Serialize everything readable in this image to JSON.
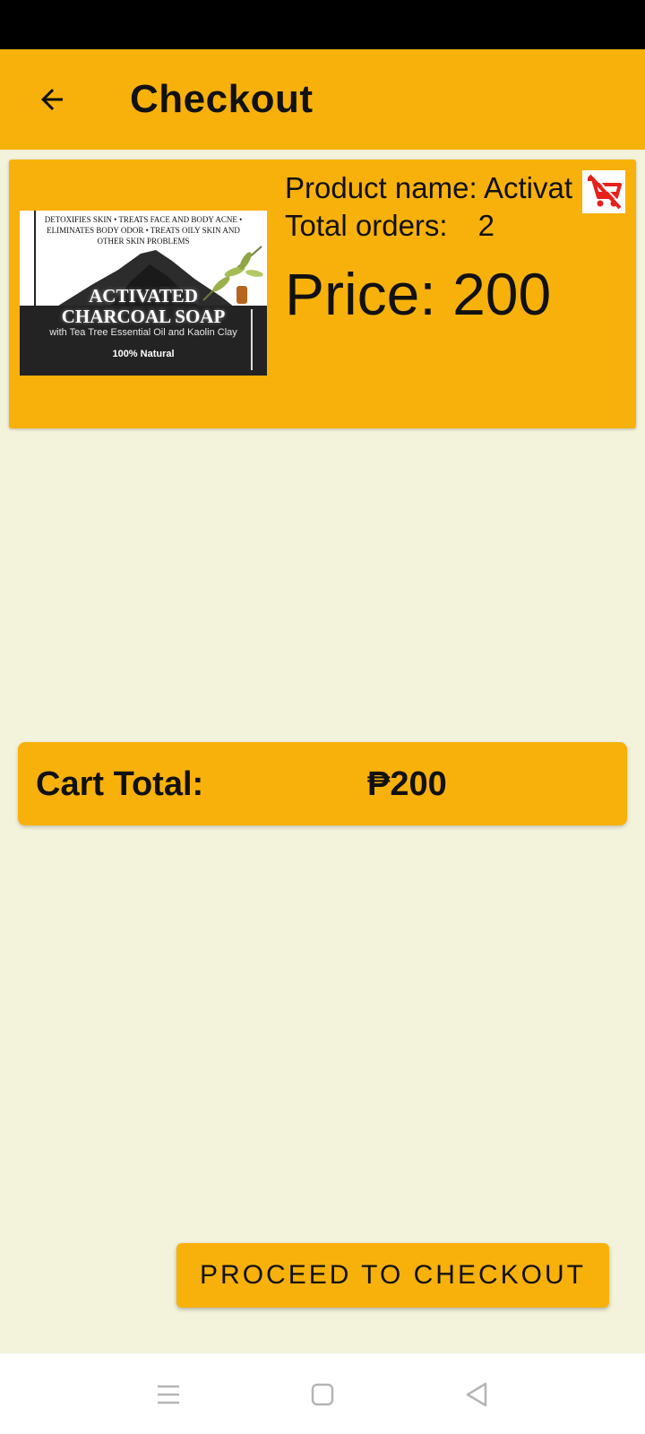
{
  "app_bar": {
    "title": "Checkout",
    "back_icon": "arrow-left-icon",
    "background_color": "#f8b10b"
  },
  "cart_item": {
    "product_name_label": "Product name:",
    "product_name": "Activated Charcoal Soap",
    "total_orders_label": "Total orders:",
    "total_orders": "2",
    "price_label": "Price:",
    "price": "200",
    "remove_icon": "remove-from-cart-icon",
    "image": {
      "header_text": "Detoxifies Skin • Treats Face and Body Acne • Eliminates Body Odor • Treats Oily Skin and Other Skin Problems",
      "title_line1": "ACTIVATED",
      "title_line2": "CHARCOAL SOAP",
      "subtitle": "with Tea Tree Essential Oil and Kaolin Clay",
      "badge": "100% Natural"
    }
  },
  "cart_total": {
    "label": "Cart Total:",
    "value": "₱200"
  },
  "checkout_button": {
    "label": "PROCEED TO CHECKOUT"
  },
  "system_nav": {
    "menu_icon": "menu-icon",
    "home_icon": "home-square-icon",
    "back_icon": "back-triangle-icon"
  },
  "colors": {
    "accent": "#f8b10b",
    "background": "#f3f3dc",
    "remove_icon": "#e8201c"
  }
}
